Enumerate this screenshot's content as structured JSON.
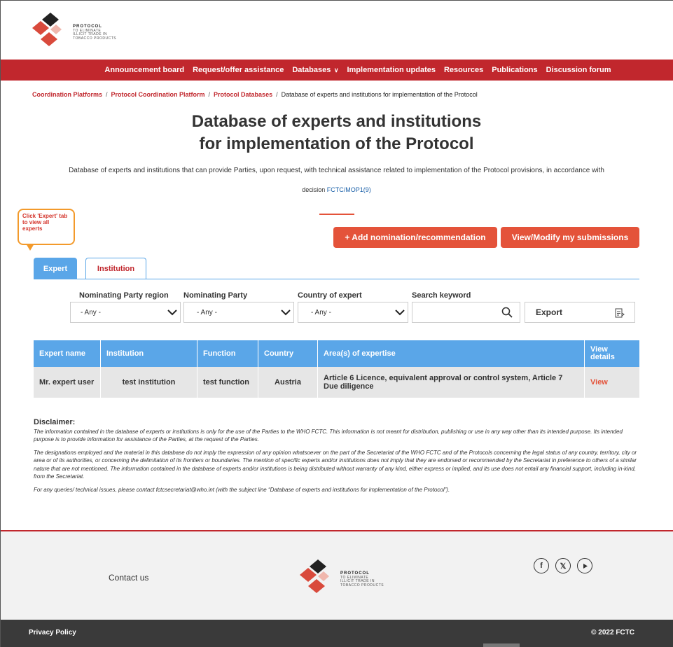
{
  "logo": {
    "line1": "PROTOCOL",
    "line2": "TO ELIMINATE",
    "line3": "ILLICIT TRADE IN",
    "line4": "TOBACCO PRODUCTS"
  },
  "nav": {
    "items": [
      {
        "label": "Announcement board"
      },
      {
        "label": "Request/offer assistance"
      },
      {
        "label": "Databases"
      },
      {
        "label": "Implementation updates"
      },
      {
        "label": "Resources"
      },
      {
        "label": "Publications"
      },
      {
        "label": "Discussion forum"
      }
    ]
  },
  "breadcrumb": {
    "items": [
      "Coordination Platforms",
      "Protocol Coordination Platform",
      "Protocol Databases"
    ],
    "current": "Database of experts and institutions for implementation of the Protocol"
  },
  "page": {
    "title_line1": "Database of experts and institutions",
    "title_line2": "for implementation of the Protocol",
    "intro": "Database of experts and institutions that can provide Parties, upon request, with technical assistance related to implementation of the Protocol provisions, in accordance with",
    "decision_prefix": "decision",
    "decision_link": "FCTC/MOP1(9)"
  },
  "callout": {
    "text": "Click 'Expert' tab to view all experts"
  },
  "actions": {
    "add": "+ Add nomination/recommendation",
    "modify": "View/Modify my submissions"
  },
  "tabs": [
    {
      "label": "Expert",
      "active": true
    },
    {
      "label": "Institution",
      "active": false
    }
  ],
  "filters": {
    "region_label": "Nominating Party region",
    "region_value": "- Any -",
    "party_label": "Nominating Party",
    "party_value": "- Any -",
    "country_label": "Country of expert",
    "country_value": "- Any -",
    "keyword_label": "Search keyword",
    "keyword_value": "",
    "export_label": "Export"
  },
  "table": {
    "headers": [
      "Expert name",
      "Institution",
      "Function",
      "Country",
      "Area(s) of expertise",
      "View details"
    ],
    "rows": [
      {
        "name": "Mr. expert user",
        "institution": "test institution",
        "function": "test function",
        "country": "Austria",
        "areas": "Article 6 Licence, equivalent approval or control system, Article 7 Due diligence",
        "view": "View"
      }
    ]
  },
  "disclaimer": {
    "heading": "Disclaimer:",
    "p1": "The information contained in the database of experts or institutions is only for the use of the Parties to the WHO FCTC. This information is not meant for distribution, publishing or use in any way other than its intended purpose. Its intended purpose is to provide information for assistance of the Parties, at the request of the Parties.",
    "p2": "The designations employed and the material in this database do not imply the expression of any opinion whatsoever on the part of the Secretariat of the WHO FCTC and of the Protocols concerning the legal status of any country, territory, city or area or of its authorities, or concerning the delimitation of its frontiers or boundaries. The mention of specific experts and/or institutions does not imply that they are endorsed or recommended by the Secretariat in preference to others of a similar nature that are not mentioned. The information contained in the database of experts and/or institutions is being distributed without warranty of any kind, either express or implied, and its use does not entail any financial support, including in-kind, from the Secretariat.",
    "p3": "For any queries/ technical issues, please contact fctcsecretariat@who.int (with the subject line “Database of experts and institutions for implementation of the Protocol”)."
  },
  "footer": {
    "contact": "Contact us",
    "privacy": "Privacy Policy",
    "copyright": "© 2022 FCTC",
    "social_icons": [
      "facebook-icon",
      "x-icon",
      "youtube-icon"
    ]
  },
  "colors": {
    "brand_red": "#c1272d",
    "accent_orange": "#e4533a",
    "tab_blue": "#5aa6e8",
    "callout_border": "#f39a2b"
  }
}
